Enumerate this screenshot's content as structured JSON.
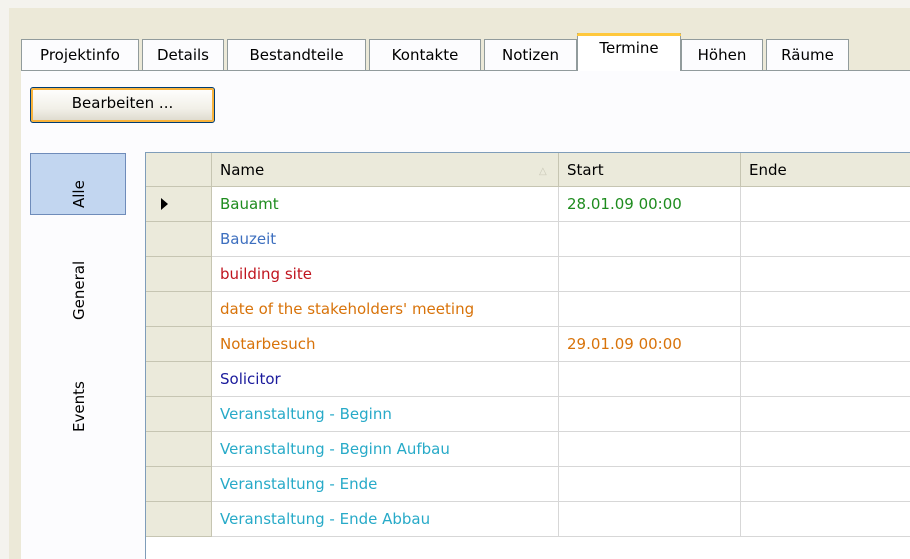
{
  "tabs": [
    {
      "label": "Projektinfo",
      "active": false
    },
    {
      "label": "Details",
      "active": false
    },
    {
      "label": "Bestandteile",
      "active": false
    },
    {
      "label": "Kontakte",
      "active": false
    },
    {
      "label": "Notizen",
      "active": false
    },
    {
      "label": "Termine",
      "active": true
    },
    {
      "label": "Höhen",
      "active": false
    },
    {
      "label": "Räume",
      "active": false
    }
  ],
  "toolbar": {
    "edit_label": "Bearbeiten ..."
  },
  "sidetabs": [
    {
      "label": "Alle",
      "active": true
    },
    {
      "label": "General",
      "active": false
    },
    {
      "label": "Events",
      "active": false
    }
  ],
  "grid": {
    "columns": [
      "Name",
      "Start",
      "Ende"
    ],
    "sort_icon": "sort-ascending-icon",
    "rows": [
      {
        "name": "Bauamt",
        "start": "28.01.09  00:00",
        "end": "",
        "color": "#1e8c1e",
        "current": true
      },
      {
        "name": "Bauzeit",
        "start": "",
        "end": "",
        "color": "#3d6fbf",
        "current": false
      },
      {
        "name": "building site",
        "start": "",
        "end": "",
        "color": "#c0141e",
        "current": false
      },
      {
        "name": "date of the stakeholders' meeting",
        "start": "",
        "end": "",
        "color": "#d8730a",
        "current": false
      },
      {
        "name": "Notarbesuch",
        "start": "29.01.09  00:00",
        "end": "",
        "color": "#d8730a",
        "current": false
      },
      {
        "name": "Solicitor",
        "start": "",
        "end": "",
        "color": "#1a1a9c",
        "current": false
      },
      {
        "name": "Veranstaltung - Beginn",
        "start": "",
        "end": "",
        "color": "#27aac8",
        "current": false
      },
      {
        "name": "Veranstaltung - Beginn Aufbau",
        "start": "",
        "end": "",
        "color": "#27aac8",
        "current": false
      },
      {
        "name": "Veranstaltung - Ende",
        "start": "",
        "end": "",
        "color": "#27aac8",
        "current": false
      },
      {
        "name": "Veranstaltung - Ende Abbau",
        "start": "",
        "end": "",
        "color": "#27aac8",
        "current": false
      }
    ]
  }
}
